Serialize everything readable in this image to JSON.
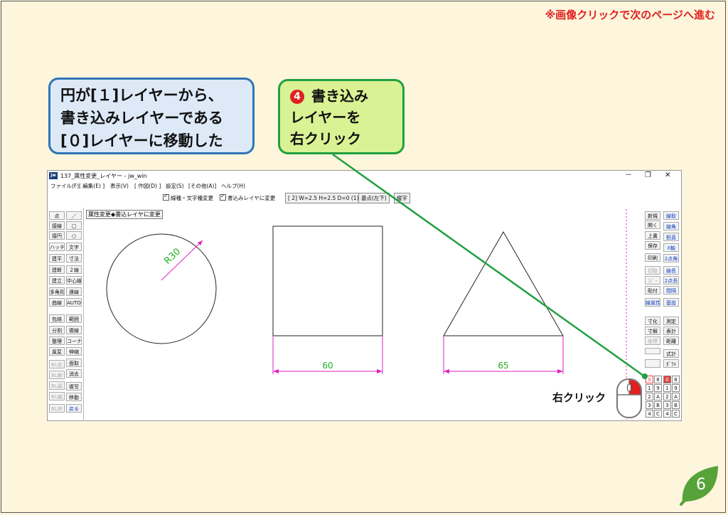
{
  "slide": {
    "top_note": "※画像クリックで次のページへ進む",
    "callout_left_lines": [
      "円が[１]レイヤーから、",
      "書き込みレイヤーである",
      "[０]レイヤーに移動した"
    ],
    "callout_step": {
      "number": "4",
      "lines": [
        "書き込み",
        "レイヤーを",
        "右クリック"
      ]
    },
    "right_click_label": "右クリック",
    "page_number": "6"
  },
  "window": {
    "title": "137_属性変更_レイヤー - jw_win",
    "controls": [
      "－",
      "❐",
      "✕"
    ],
    "menu": [
      "ファイル(F)",
      "[ 編集(E) ]",
      "表示(V)",
      "[ 作図(D) ]",
      "設定(S)",
      "[その他(A)]",
      "ヘルプ(H)"
    ],
    "options": {
      "chk1": "線種・文字種変更",
      "chk2": "書込みレイヤに変更",
      "info": "[ 2]  W=2.5  H=2.5  D=0 (1)",
      "btn_base": "基点(左下)",
      "btn_glyph": "縦字"
    },
    "status": "属性変更◆書込レイヤに変更"
  },
  "left_tools": {
    "col1": [
      "点",
      "接線",
      "接円",
      "ハッチ",
      "建平",
      "建断",
      "建立",
      "多角形",
      "曲線",
      "包絡",
      "分割",
      "整理",
      "属変",
      "BL化",
      "BL解",
      "BL属",
      "BL編",
      "BL終"
    ],
    "col2": [
      "／",
      "□",
      "○",
      "文字",
      "寸法",
      "２線",
      "中心線",
      "連線",
      "AUTO",
      "範囲",
      "複線",
      "コーナー",
      "伸縮",
      "面取",
      "消去",
      "複写",
      "移動",
      "戻る"
    ]
  },
  "right_tools": {
    "col1": [
      "新規",
      "開く",
      "上書",
      "保存",
      "印刷",
      "切取",
      "ｺﾋﾟｰ",
      "貼付",
      "線属性",
      "寸化",
      "寸解",
      "座標",
      "",
      "",
      ""
    ],
    "col2": [
      "線取",
      "線角",
      "鉛直",
      "X軸",
      "2点角",
      "線長",
      "2点長",
      "間隔",
      "基設",
      "測定",
      "表計",
      "距離",
      "式計",
      "ｶﾞﾗﾒ",
      ""
    ]
  },
  "layers": {
    "rows": [
      [
        "0",
        "8",
        "0",
        "8"
      ],
      [
        "1",
        "9",
        "1",
        "9"
      ],
      [
        "2",
        "A",
        "2",
        "A"
      ],
      [
        "3",
        "B",
        "3",
        "B"
      ],
      [
        "4",
        "C",
        "4",
        "C"
      ]
    ]
  },
  "drawing": {
    "circle_label": "R30",
    "dim_rect": "60",
    "dim_triangle": "65"
  },
  "colors": {
    "callout_blue_fill": "#dde9f7",
    "callout_blue_border": "#2e75b6",
    "callout_green_fill": "#d9f294",
    "callout_green_border": "#20a040",
    "dimension": "#e020c0",
    "dimension_text": "#20b020",
    "arrow": "#20a040",
    "note_red": "#e02020"
  }
}
